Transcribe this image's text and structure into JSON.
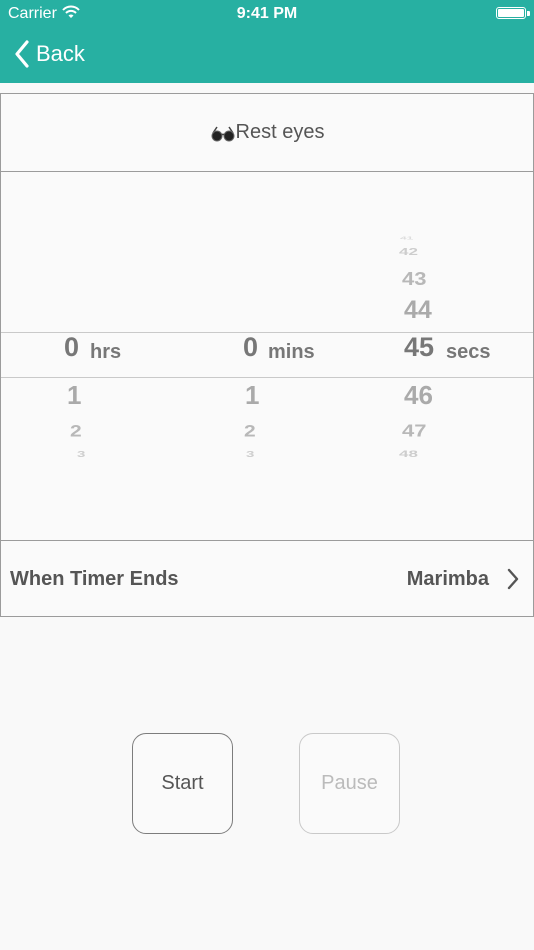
{
  "status_bar": {
    "carrier": "Carrier",
    "time": "9:41 PM"
  },
  "nav": {
    "back_label": "Back"
  },
  "card": {
    "title_icon": "eyeglasses-icon",
    "title": "Rest eyes"
  },
  "picker": {
    "hours": {
      "selected": "0",
      "unit": "hrs",
      "below": [
        "1",
        "2",
        "3"
      ]
    },
    "minutes": {
      "selected": "0",
      "unit": "mins",
      "below": [
        "1",
        "2",
        "3"
      ]
    },
    "seconds": {
      "selected": "45",
      "unit": "secs",
      "above": [
        "41",
        "42",
        "43",
        "44"
      ],
      "below": [
        "46",
        "47",
        "48"
      ]
    }
  },
  "timer_end": {
    "label": "When Timer Ends",
    "value": "Marimba"
  },
  "buttons": {
    "start": "Start",
    "pause": "Pause"
  },
  "colors": {
    "accent": "#27b0a2"
  }
}
